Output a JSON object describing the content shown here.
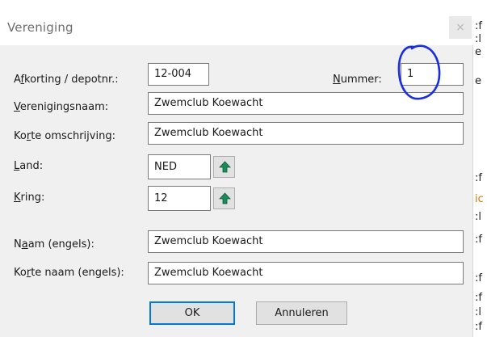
{
  "dialog": {
    "title": "Vereniging",
    "close_label": "×"
  },
  "form": {
    "afkorting": {
      "label_pre": "A",
      "label_accel": "f",
      "label_post": "korting / depotnr.:",
      "value": "12-004"
    },
    "nummer": {
      "label_pre": "",
      "label_accel": "N",
      "label_post": "ummer:",
      "value": "1"
    },
    "verenigingsnaam": {
      "label_pre": "",
      "label_accel": "V",
      "label_post": "erenigingsnaam:",
      "value": "Zwemclub Koewacht"
    },
    "korte_omschrijving": {
      "label_pre": "Ko",
      "label_accel": "r",
      "label_post": "te omschrijving:",
      "value": "Zwemclub Koewacht"
    },
    "land": {
      "label_pre": "",
      "label_accel": "L",
      "label_post": "and:",
      "value": "NED"
    },
    "kring": {
      "label_pre": "",
      "label_accel": "K",
      "label_post": "ring:",
      "value": "12"
    },
    "naam_engels": {
      "label_pre": "N",
      "label_accel": "a",
      "label_post": "am (engels):",
      "value": "Zwemclub Koewacht"
    },
    "korte_naam_engels": {
      "label_pre": "Ko",
      "label_accel": "r",
      "label_post": "te naam (engels):",
      "value": "Zwemclub Koewacht"
    }
  },
  "buttons": {
    "ok": "OK",
    "cancel": "Annuleren"
  },
  "icons": {
    "lookup": "green-up-arrow-icon"
  },
  "colors": {
    "arrow_green": "#1e8a5a",
    "annotation_blue": "#1a2ee0",
    "focus_blue": "#0078d7"
  },
  "background": {
    "glyphs": [
      ":f",
      ":l",
      "e",
      "e",
      ":f",
      "ic",
      ":l",
      ":f",
      ":f",
      ":f",
      ":l",
      ":f"
    ]
  }
}
